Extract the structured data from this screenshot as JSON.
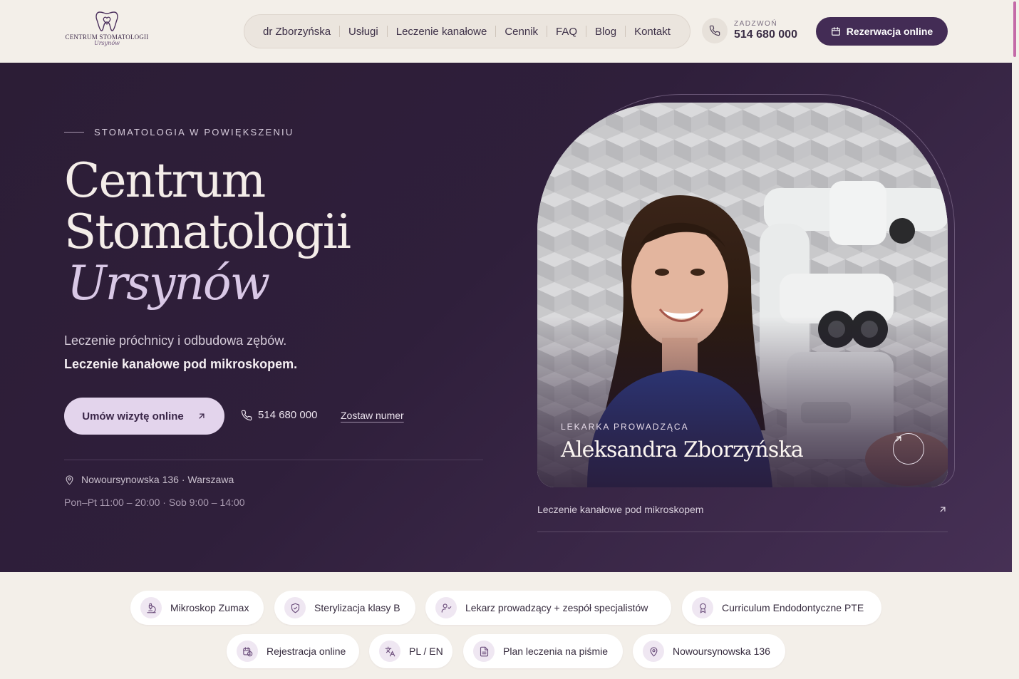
{
  "header": {
    "logo_text": "CENTRUM STOMATOLOGII",
    "logo_script": "Ursynów",
    "nav": [
      "dr Zborzyńska",
      "Usługi",
      "Leczenie kanałowe",
      "Cennik",
      "FAQ",
      "Blog",
      "Kontakt"
    ],
    "call_label": "ZADZWOŃ",
    "call_number": "514 680 000",
    "reserve_label": "Rezerwacja online"
  },
  "hero": {
    "eyebrow": "STOMATOLOGIA W POWIĘKSZENIU",
    "title_line1": "Centrum",
    "title_line2": "Stomatologii",
    "title_line3": "Ursynów",
    "subtitle1": "Leczenie próchnicy i odbudowa zębów.",
    "subtitle2": "Leczenie kanałowe pod mikroskopem.",
    "cta_label": "Umów wizytę online",
    "phone": "514 680 000",
    "leave_number": "Zostaw numer",
    "address": "Nowoursynowska 136 · Warszawa",
    "hours": "Pon–Pt 11:00 – 20:00 · Sob 9:00 – 14:00",
    "doctor_role": "LEKARKA PROWADZĄCA",
    "doctor_name": "Aleksandra Zborzyńska",
    "caption": "Leczenie kanałowe pod mikroskopem"
  },
  "features": [
    {
      "label": "Mikroskop Zumax",
      "icon": "microscope-icon"
    },
    {
      "label": "Sterylizacja klasy B",
      "icon": "shield-check-icon"
    },
    {
      "label": "Lekarz prowadzący + zespół specjalistów",
      "icon": "user-check-icon"
    },
    {
      "label": "Curriculum Endodontyczne PTE",
      "icon": "award-icon"
    },
    {
      "label": "Rejestracja online",
      "icon": "calendar-clock-icon"
    },
    {
      "label": "PL / EN",
      "icon": "translate-icon"
    },
    {
      "label": "Plan leczenia na piśmie",
      "icon": "document-icon"
    },
    {
      "label": "Nowoursynowska 136",
      "icon": "map-pin-icon"
    }
  ],
  "colors": {
    "brand": "#432c55",
    "hero_bg": "#2f1f3b",
    "cta_bg": "#e3d4ec",
    "page_bg": "#f3efe9"
  }
}
